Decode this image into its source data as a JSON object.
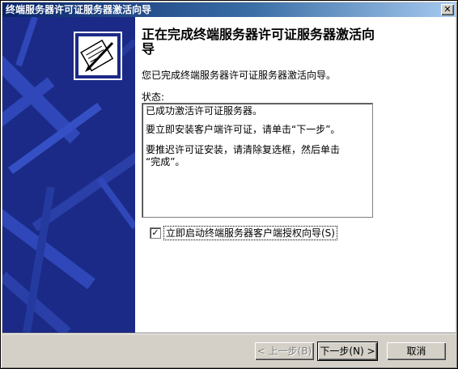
{
  "window": {
    "title": "终端服务器许可证服务器激活向导",
    "close_glyph": "✕"
  },
  "main": {
    "heading": "正在完成终端服务器许可证服务器激活向导",
    "description": "您已完成终端服务器许可证服务器激活向导。",
    "status_label": "状态:",
    "status_lines": [
      "已成功激活许可证服务器。",
      "要立即安装客户端许可证，请单击“下一步”。",
      "要推迟许可证安装，请清除复选框，然后单击",
      "“完成”。"
    ],
    "checkbox": {
      "label": "立即启动终端服务器客户端授权向导(S)",
      "checked": true,
      "mark": "✓"
    }
  },
  "buttons": {
    "back": "< 上一步(B)",
    "next": "下一步(N) >",
    "cancel": "取消"
  },
  "icons": {
    "wizard_icon": "certificate-pen-icon"
  },
  "colors": {
    "sidebar": "#1b2a87",
    "title_start": "#0a246a",
    "title_end": "#a6caf0"
  }
}
